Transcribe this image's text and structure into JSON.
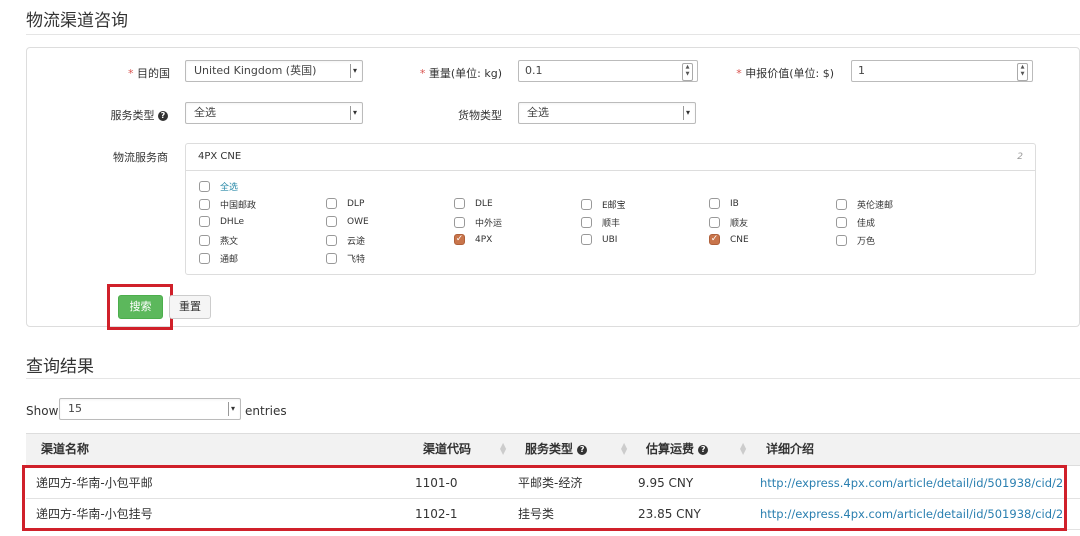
{
  "page_title": "物流渠道咨询",
  "form": {
    "destination": {
      "label": "目的国",
      "value": "United Kingdom (英国)"
    },
    "weight": {
      "label": "重量(单位: kg)",
      "value": "0.1"
    },
    "declared_value": {
      "label": "申报价值(单位: $)",
      "value": "1"
    },
    "service_type": {
      "label": "服务类型",
      "value": "全选"
    },
    "cargo_type": {
      "label": "货物类型",
      "value": "全选"
    },
    "provider": {
      "label": "物流服务商",
      "selected_text": "4PX CNE",
      "count": "2",
      "select_all": "全选",
      "options": [
        {
          "label": "中国邮政",
          "checked": false
        },
        {
          "label": "DLP",
          "checked": false
        },
        {
          "label": "DLE",
          "checked": false
        },
        {
          "label": "E邮宝",
          "checked": false
        },
        {
          "label": "IB",
          "checked": false
        },
        {
          "label": "英伦速邮",
          "checked": false
        },
        {
          "label": "DHLe",
          "checked": false
        },
        {
          "label": "OWE",
          "checked": false
        },
        {
          "label": "中外运",
          "checked": false
        },
        {
          "label": "顺丰",
          "checked": false
        },
        {
          "label": "顺友",
          "checked": false
        },
        {
          "label": "佳成",
          "checked": false
        },
        {
          "label": "燕文",
          "checked": false
        },
        {
          "label": "云途",
          "checked": false
        },
        {
          "label": "4PX",
          "checked": true
        },
        {
          "label": "UBI",
          "checked": false
        },
        {
          "label": "CNE",
          "checked": true
        },
        {
          "label": "万色",
          "checked": false
        },
        {
          "label": "通邮",
          "checked": false
        },
        {
          "label": "飞特",
          "checked": false
        }
      ]
    },
    "search_label": "搜索",
    "reset_label": "重置"
  },
  "results": {
    "title": "查询结果",
    "show_label": "Show",
    "entries_value": "15",
    "entries_label": "entries",
    "columns": [
      "渠道名称",
      "渠道代码",
      "服务类型",
      "估算运费",
      "详细介绍"
    ],
    "rows": [
      [
        "递四方-华南-小包平邮",
        "1101-0",
        "平邮类-经济",
        "9.95 CNY",
        "http://express.4px.com/article/detail/id/501938/cid/2"
      ],
      [
        "递四方-华南-小包挂号",
        "1102-1",
        "挂号类",
        "23.85 CNY",
        "http://express.4px.com/article/detail/id/501938/cid/2"
      ]
    ]
  },
  "colors": {
    "accent_green": "#5cb85c",
    "highlight_red": "#d0202a",
    "check_orange": "#c9754b",
    "link_blue": "#2a7fb0"
  }
}
